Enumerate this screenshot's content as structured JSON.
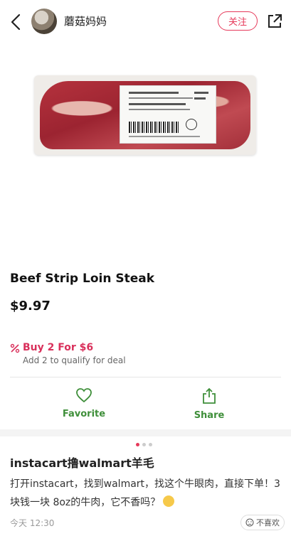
{
  "header": {
    "username": "蘑菇妈妈",
    "follow_label": "关注",
    "icons": [
      "back-icon",
      "share-icon"
    ]
  },
  "product": {
    "title": "Beef Strip Loin Steak",
    "price": "$9.97",
    "deal_title": "Buy 2 For $6",
    "deal_subtitle": "Add 2 to qualify for deal"
  },
  "actions": [
    {
      "label": "Favorite",
      "icon": "heart-icon"
    },
    {
      "label": "Share",
      "icon": "share-up-icon"
    }
  ],
  "carousel": {
    "count": 3,
    "active": 1
  },
  "note": {
    "title": "instacart撸walmart羊毛",
    "body": "打开instacart，找到walmart，找这个牛眼肉，直接下单！3块钱一块 8oz的牛肉，它不香吗？",
    "time": "今天 12:30",
    "dislike_label": "不喜欢"
  },
  "colors": {
    "accent": "#e6395a",
    "green": "#3f8f3a",
    "deal": "#d9305b"
  }
}
